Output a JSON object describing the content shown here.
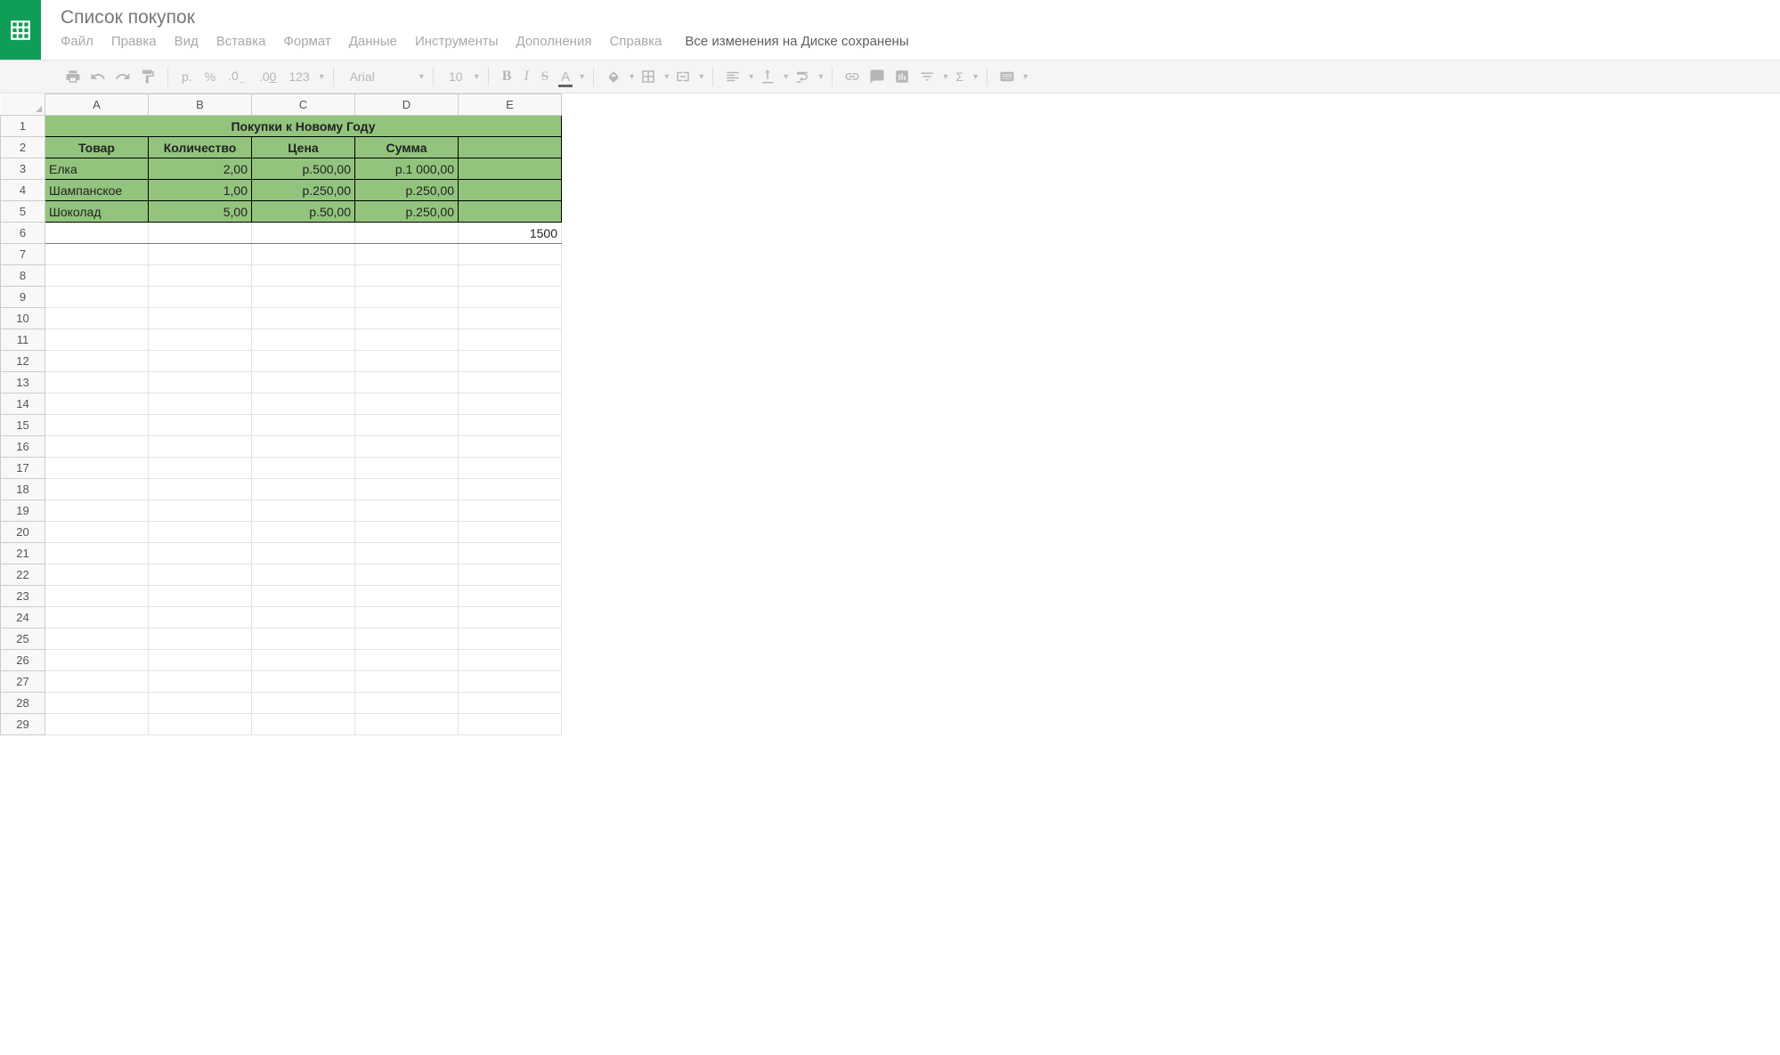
{
  "doc_title": "Список покупок",
  "menu": {
    "file": "Файл",
    "edit": "Правка",
    "view": "Вид",
    "insert": "Вставка",
    "format": "Формат",
    "data": "Данные",
    "tools": "Инструменты",
    "addons": "Дополнения",
    "help": "Справка"
  },
  "save_status": "Все изменения на Диске сохранены",
  "toolbar": {
    "currency": "р.",
    "percent": "%",
    "dec_dec": ".0",
    "inc_dec": ".00",
    "num_fmt": "123",
    "font_name": "Arial",
    "font_size": "10",
    "bold": "B",
    "italic": "I",
    "strike": "S",
    "text_color": "A",
    "sigma": "Σ"
  },
  "columns": [
    "A",
    "B",
    "C",
    "D",
    "E"
  ],
  "sheet": {
    "title_row": "Покупки к Новому Году",
    "headers": {
      "a": "Товар",
      "b": "Количество",
      "c": "Цена",
      "d": "Сумма",
      "e": ""
    },
    "rows": [
      {
        "a": "Елка",
        "b": "2,00",
        "c": "р.500,00",
        "d": "р.1 000,00"
      },
      {
        "a": "Шампанское",
        "b": "1,00",
        "c": "р.250,00",
        "d": "р.250,00"
      },
      {
        "a": "Шоколад",
        "b": "5,00",
        "c": "р.50,00",
        "d": "р.250,00"
      }
    ],
    "total_e6": "1500"
  },
  "row_count": 29
}
